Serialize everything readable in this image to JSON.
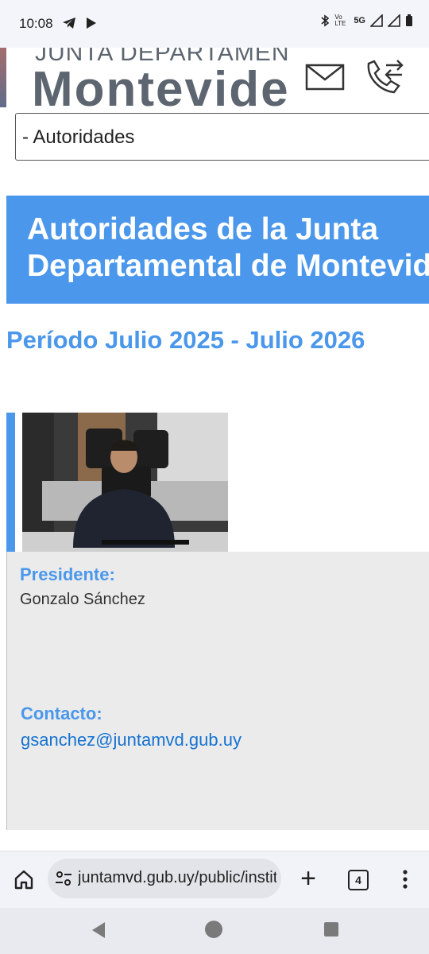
{
  "status_bar": {
    "time": "10:08",
    "left_icons": [
      "telegram-icon",
      "play-icon"
    ],
    "right_icons": [
      "bluetooth-icon",
      "volte-icon",
      "5g-signal-icon",
      "signal-icon",
      "battery-icon"
    ],
    "network_label": "5G",
    "volte_label": "Vo LTE"
  },
  "header": {
    "logo_line1": "JUNTA DEPARTAMENTAL DE",
    "logo_line2": "Montevideo",
    "icons": [
      "mail-icon",
      "phone-transfer-icon"
    ]
  },
  "nav_select": {
    "selected": "- Autoridades"
  },
  "page": {
    "title": "Autoridades de la Junta Departamental de Montevideo",
    "title_line1": "Autoridades de la Junta",
    "title_line2": "Departamental de Montevideo",
    "period": "Período Julio 2025 - Julio 2026"
  },
  "authority_card": {
    "role_label": "Presidente:",
    "name": "Gonzalo Sánchez",
    "contact_label": "Contacto:",
    "email": "gsanchez@juntamvd.gub.uy"
  },
  "browser": {
    "url": "juntamvd.gub.uy/public/institucional",
    "tab_count": "4"
  },
  "colors": {
    "accent": "#4a97eb",
    "link": "#1673d1",
    "card_bg": "#ebebeb"
  }
}
